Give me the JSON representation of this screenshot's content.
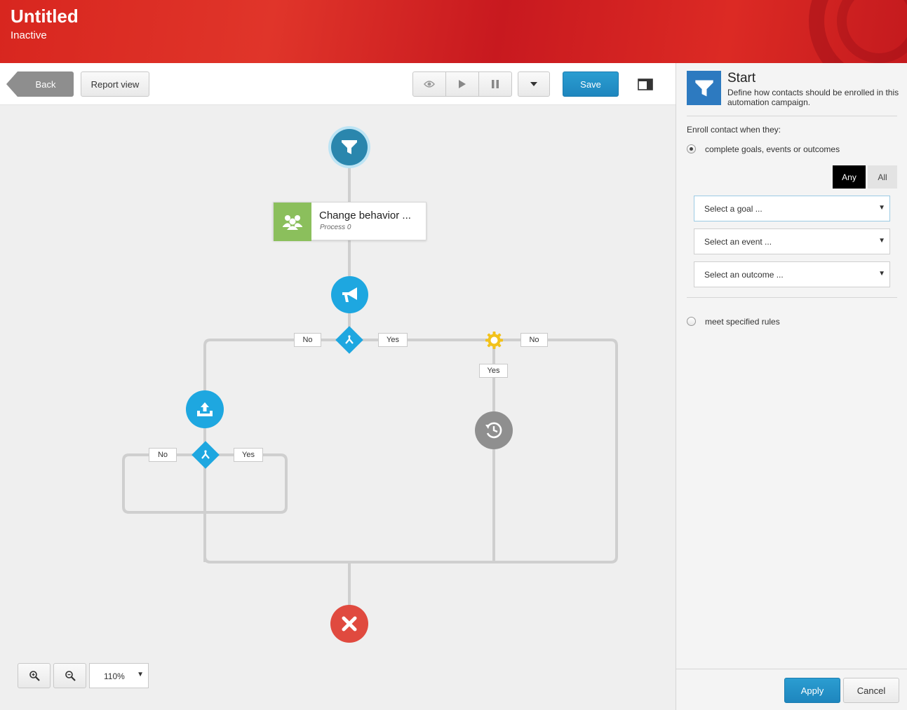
{
  "header": {
    "title": "Untitled",
    "status": "Inactive"
  },
  "toolbar": {
    "back_label": "Back",
    "report_view_label": "Report view",
    "save_label": "Save"
  },
  "flow": {
    "process_name": "Change behavior ...",
    "process_sub": "Process 0",
    "labels": {
      "no_1": "No",
      "yes_1": "Yes",
      "no_2": "No",
      "yes_2": "Yes",
      "no_3": "No",
      "yes_3": "Yes"
    }
  },
  "zoom": {
    "level": "110%"
  },
  "panel": {
    "title": "Start",
    "description": "Define how contacts should be enrolled in this automation campaign.",
    "enroll_label": "Enroll contact when they:",
    "option_goals": "complete goals, events or outcomes",
    "any_label": "Any",
    "all_label": "All",
    "goal_placeholder": "Select a goal ...",
    "event_placeholder": "Select an event ...",
    "outcome_placeholder": "Select an outcome ...",
    "option_rules": "meet specified rules",
    "apply_label": "Apply",
    "cancel_label": "Cancel"
  },
  "colors": {
    "header_red": "#d8261f",
    "accent_blue": "#1ea7e0",
    "save_blue": "#2196c9",
    "start_node": "#2a86ad",
    "end_node": "#e04a3f",
    "wait_node": "#8f8f8f",
    "process_green": "#8bbf5c"
  }
}
